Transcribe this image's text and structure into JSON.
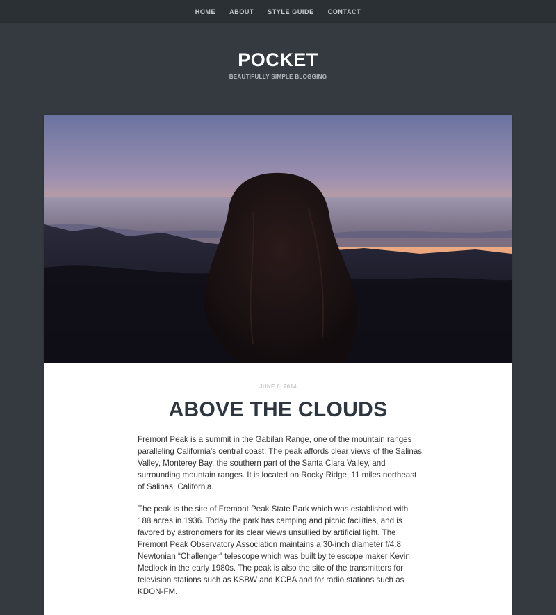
{
  "nav": {
    "items": [
      "HOME",
      "ABOUT",
      "STYLE GUIDE",
      "CONTACT"
    ]
  },
  "site": {
    "title": "POCKET",
    "tagline": "BEAUTIFULLY SIMPLE BLOGGING"
  },
  "post": {
    "date": "JUNE 6, 2014",
    "title": "ABOVE THE CLOUDS",
    "paragraphs": [
      "Fremont Peak is a summit in the Gabilan Range, one of the mountain ranges paralleling California's central coast. The peak affords clear views of the Salinas Valley, Monterey Bay, the southern part of the Santa Clara Valley, and surrounding mountain ranges. It is located on Rocky Ridge, 11 miles northeast of Salinas, California.",
      "The peak is the site of Fremont Peak State Park which was established with 188 acres in 1936. Today the park has camping and picnic facilities, and is favored by astronomers for its clear views unsullied by artificial light. The Fremont Peak Observatory Association maintains a 30-inch diameter f/4.8 Newtonian “Challenger” telescope which was built by telescope maker Kevin Medlock in the early 1980s. The peak is also the site of the transmitters for television stations such as KSBW and KCBA and for radio stations such as KDON-FM."
    ]
  },
  "colors": {
    "page_background": "#343a40",
    "nav_background": "#2b3035",
    "title_text": "#2e3740"
  }
}
